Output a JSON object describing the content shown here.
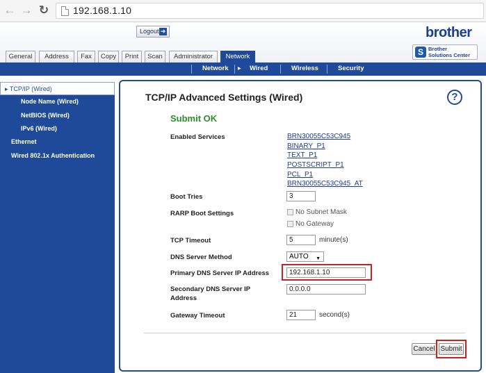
{
  "browser": {
    "url": "192.168.1.10"
  },
  "header": {
    "logout_label": "Logout",
    "brand": "brother",
    "solutions_line1": "Brother",
    "solutions_line2": "Solutions Center"
  },
  "tabs": [
    {
      "label": "General"
    },
    {
      "label": "Address"
    },
    {
      "label": "Fax"
    },
    {
      "label": "Copy"
    },
    {
      "label": "Print"
    },
    {
      "label": "Scan"
    },
    {
      "label": "Administrator"
    },
    {
      "label": "Network",
      "active": true
    }
  ],
  "subnav": [
    {
      "label": "Network"
    },
    {
      "label": "Wired",
      "active": true
    },
    {
      "label": "Wireless"
    },
    {
      "label": "Security"
    }
  ],
  "sidebar": {
    "items": [
      {
        "label": "TCP/IP (Wired)",
        "active": true
      },
      {
        "label": "Node Name (Wired)"
      },
      {
        "label": "NetBIOS (Wired)"
      },
      {
        "label": "IPv6 (Wired)"
      },
      {
        "label": "Ethernet"
      },
      {
        "label": "Wired 802.1x Authentication"
      }
    ]
  },
  "main": {
    "title": "TCP/IP Advanced Settings (Wired)",
    "help_symbol": "?",
    "status": "Submit OK",
    "enabled_services_label": "Enabled Services",
    "services": [
      "BRN30055C53C945",
      "BINARY_P1",
      "TEXT_P1",
      "POSTSCRIPT_P1",
      "PCL_P1",
      "BRN30055C53C945_AT"
    ],
    "boot_tries_label": "Boot Tries",
    "boot_tries_value": "3",
    "rarp_label": "RARP Boot Settings",
    "rarp_options": [
      "No Subnet Mask",
      "No Gateway"
    ],
    "tcp_timeout_label": "TCP Timeout",
    "tcp_timeout_value": "5",
    "tcp_timeout_unit": "minute(s)",
    "dns_method_label": "DNS Server Method",
    "dns_method_value": "AUTO",
    "primary_dns_label": "Primary DNS Server IP Address",
    "primary_dns_value": "192.168.1.10",
    "secondary_dns_label_line1": "Secondary DNS Server IP",
    "secondary_dns_label_line2": "Address",
    "secondary_dns_value": "0.0.0.0",
    "gateway_timeout_label": "Gateway Timeout",
    "gateway_timeout_value": "21",
    "gateway_timeout_unit": "second(s)",
    "cancel_label": "Cancel",
    "submit_label": "Submit"
  },
  "colors": {
    "brand_blue": "#1f4a9a",
    "success_green": "#2e8b2e",
    "highlight_red": "#cc1f1f"
  }
}
